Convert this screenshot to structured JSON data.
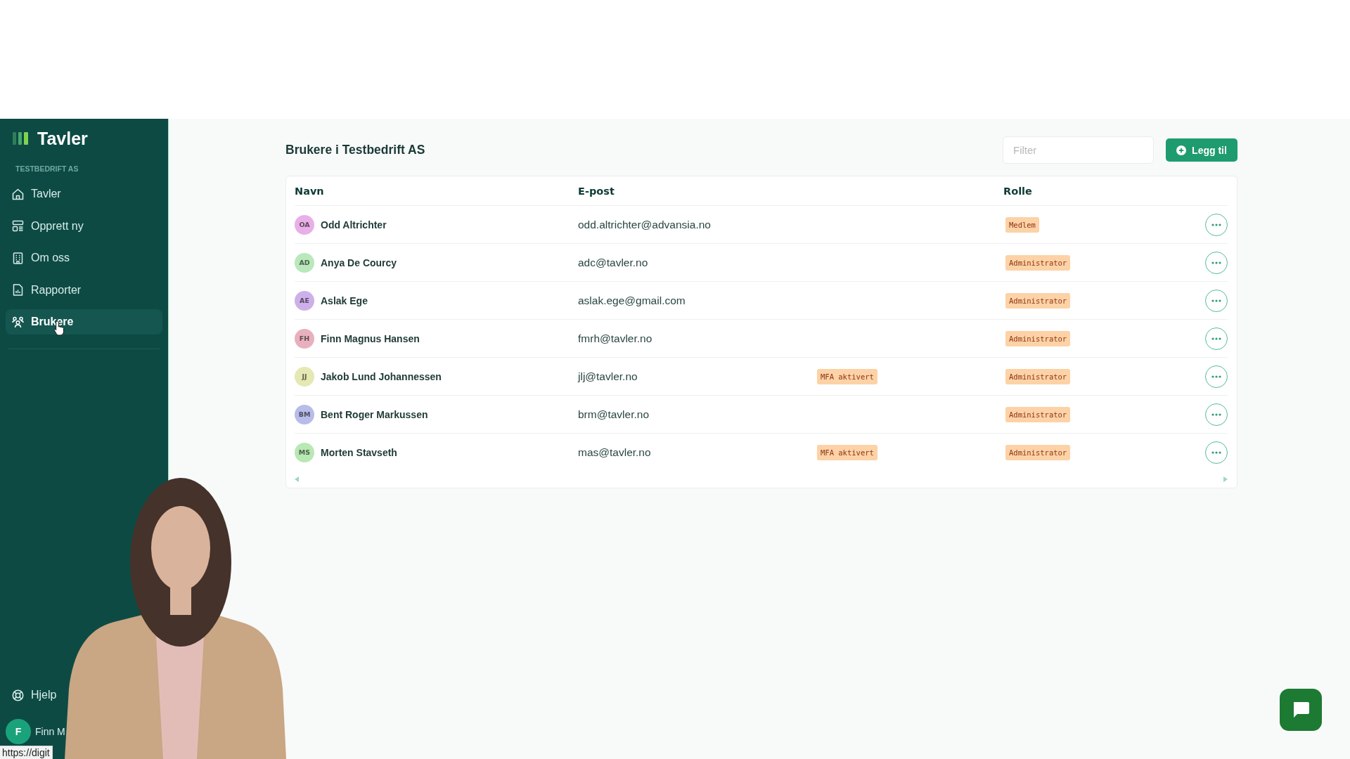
{
  "sidebar": {
    "logo": "Tavler",
    "org": "TESTBEDRIFT AS",
    "items": [
      {
        "label": "Tavler",
        "selected": false
      },
      {
        "label": "Opprett ny",
        "selected": false
      },
      {
        "label": "Om oss",
        "selected": false
      },
      {
        "label": "Rapporter",
        "selected": false
      },
      {
        "label": "Brukere",
        "selected": true
      }
    ],
    "help": "Hjelp",
    "user": {
      "initial": "F",
      "name": "Finn M"
    }
  },
  "page": {
    "title": "Brukere i Testbedrift AS",
    "filter": {
      "placeholder": "Filter"
    },
    "add_button": "Legg til"
  },
  "table": {
    "columns": [
      "Navn",
      "E-post",
      "Rolle"
    ],
    "rows": [
      {
        "initials": "OA",
        "color": "#e8b0e6",
        "name": "Odd Altrichter",
        "email": "odd.altrichter@advansia.no",
        "role": "Medlem"
      },
      {
        "initials": "AD",
        "color": "#b8e8bc",
        "name": "Anya De Courcy",
        "email": "adc@tavler.no",
        "role": "Administrator"
      },
      {
        "initials": "AE",
        "color": "#cdb0ea",
        "name": "Aslak Ege",
        "email": "aslak.ege@gmail.com",
        "role": "Administrator"
      },
      {
        "initials": "FH",
        "color": "#e8b0be",
        "name": "Finn Magnus Hansen",
        "email": "fmrh@tavler.no",
        "role": "Administrator"
      },
      {
        "initials": "JJ",
        "color": "#e6e8b4",
        "name": "Jakob Lund Johannessen",
        "email": "jlj@tavler.no",
        "mfa": "MFA aktivert",
        "role": "Administrator"
      },
      {
        "initials": "BM",
        "color": "#b8bce8",
        "name": "Bent Roger Markussen",
        "email": "brm@tavler.no",
        "role": "Administrator"
      },
      {
        "initials": "MS",
        "color": "#b8e8b4",
        "name": "Morten Stavseth",
        "email": "mas@tavler.no",
        "mfa": "MFA aktivert",
        "role": "Administrator"
      }
    ]
  },
  "status_bar": {
    "url": "https://digit"
  }
}
